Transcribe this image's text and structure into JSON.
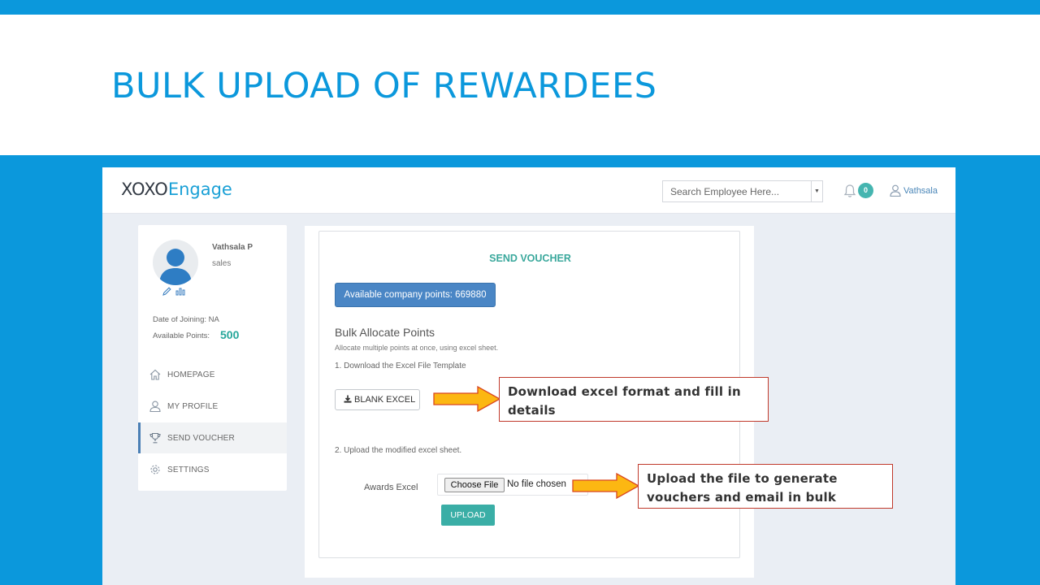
{
  "slide": {
    "title": "BULK UPLOAD OF REWARDEES"
  },
  "colors": {
    "slide_blue": "#0b98dc",
    "teal": "#3aaea6",
    "button_blue": "#4a86c5",
    "arrow_fill": "#fcb712",
    "callout_border": "#c0392b"
  },
  "header": {
    "logo_part1": "XOXO",
    "logo_part2": "Engage",
    "search_placeholder": "Search Employee Here...",
    "notification_count": "0",
    "user_name": "Vathsala"
  },
  "profile": {
    "name": "Vathsala P",
    "department": "sales",
    "date_of_joining": "Date of Joining: NA",
    "available_points_label": "Available Points:",
    "available_points_value": "500"
  },
  "nav": {
    "items": [
      {
        "label": "HOMEPAGE",
        "icon": "home-icon"
      },
      {
        "label": "MY PROFILE",
        "icon": "user-icon"
      },
      {
        "label": "SEND VOUCHER",
        "icon": "trophy-icon",
        "active": true
      },
      {
        "label": "SETTINGS",
        "icon": "gear-icon"
      }
    ]
  },
  "main": {
    "title": "SEND VOUCHER",
    "points_button": "Available company points: 669880",
    "bulk_title": "Bulk Allocate Points",
    "bulk_subtitle": "Allocate multiple points at once, using excel sheet.",
    "step1": "1. Download the Excel File Template",
    "blank_excel_button": "BLANK EXCEL",
    "step2": "2. Upload the modified excel sheet.",
    "awards_label": "Awards Excel",
    "choose_file_button": "Choose File",
    "no_file_text": "No file chosen",
    "upload_button": "UPLOAD"
  },
  "callouts": {
    "download": "Download excel format and fill in details",
    "upload": "Upload the file to generate vouchers and email in bulk"
  }
}
